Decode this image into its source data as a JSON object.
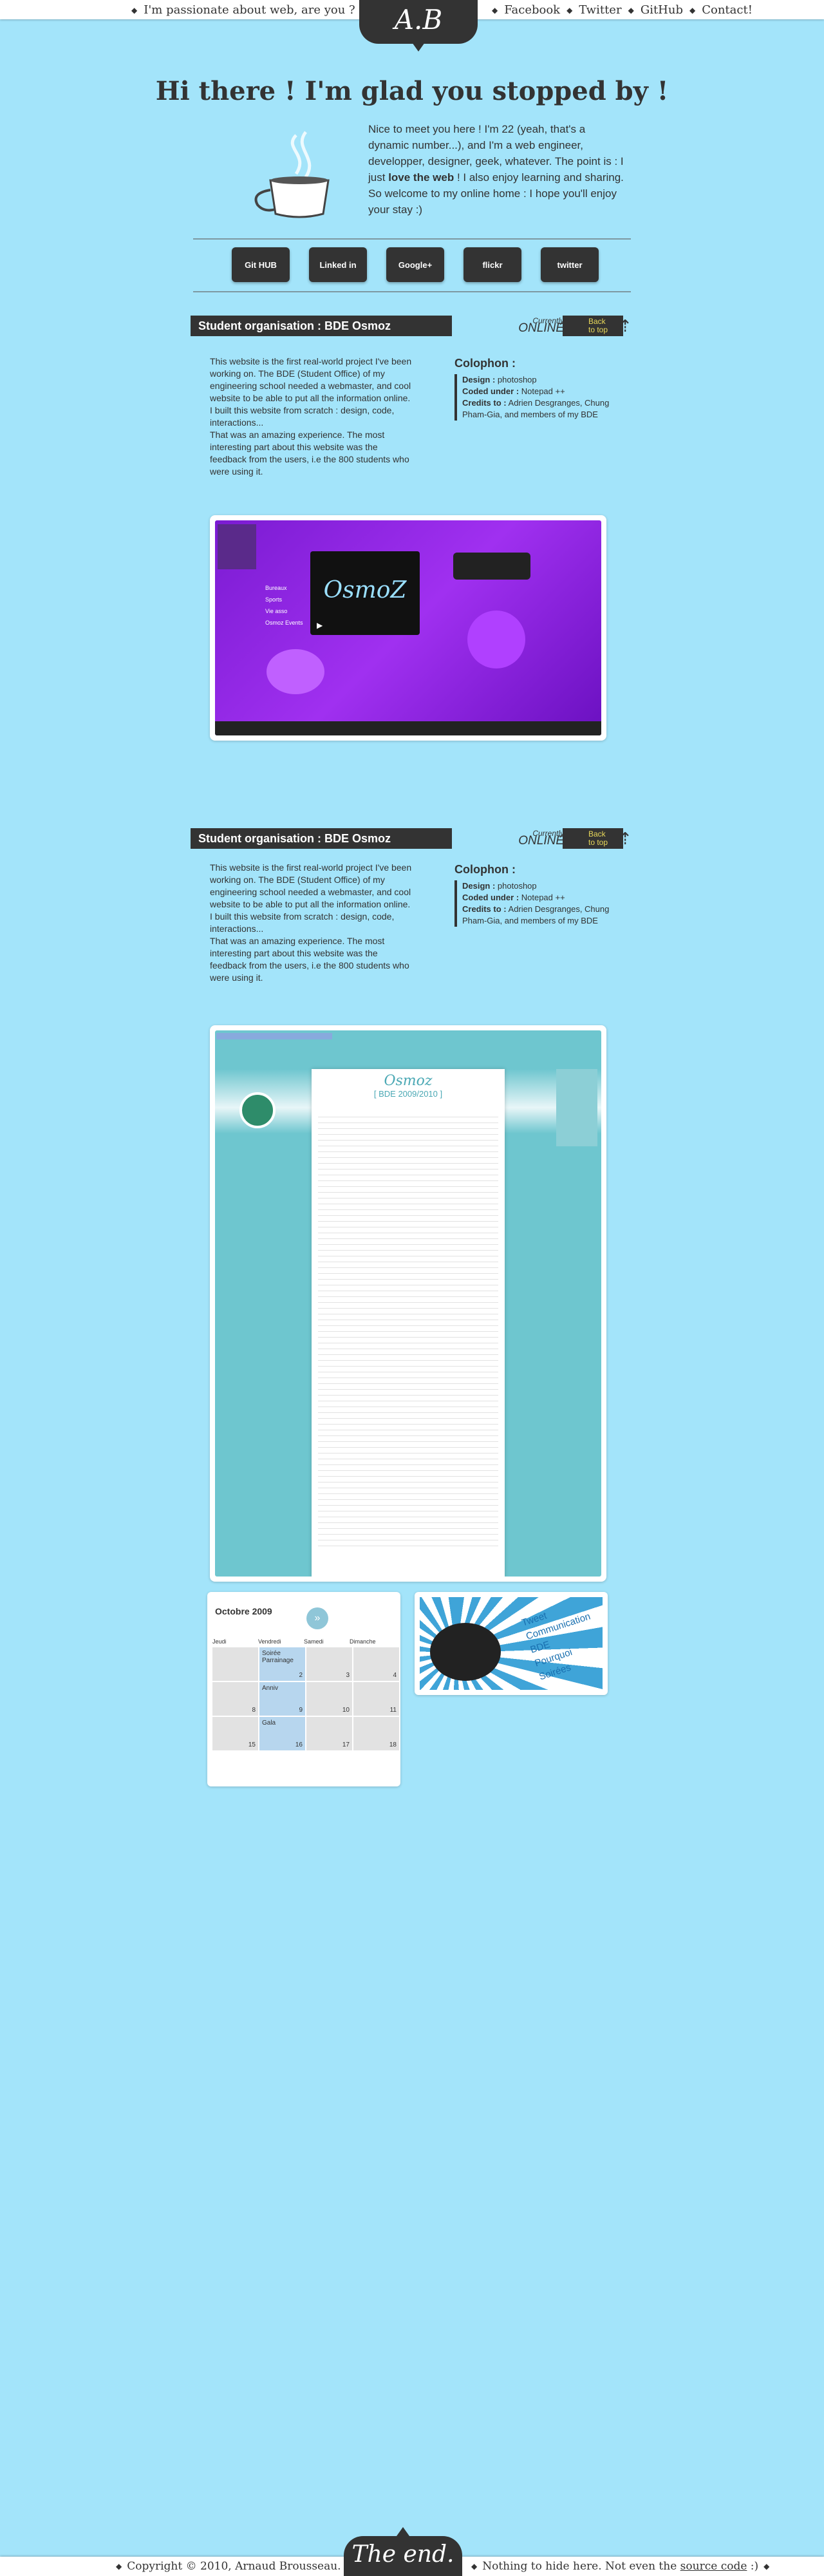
{
  "nav": {
    "tagline": "I'm passionate about web, are you ?",
    "links": [
      "Facebook",
      "Twitter",
      "GitHub",
      "Contact!"
    ],
    "separator": "◆"
  },
  "logo": "A.B",
  "intro": {
    "title": "Hi there ! I'm glad you stopped by !",
    "text_before_bold": "Nice to meet you here ! I'm 22 (yeah, that's a dynamic number...), and I'm a  web engineer, developper, designer, geek, whatever. The point is : I just ",
    "text_bold": "love the web",
    "text_after_bold": " ! I also enjoy learning and sharing. So welcome to my online home : I hope you'll enjoy your stay :)"
  },
  "social": [
    {
      "icon": "github-icon",
      "label": "Git HUB"
    },
    {
      "icon": "linkedin-icon",
      "label": "Linked in"
    },
    {
      "icon": "googleplus-icon",
      "label": "Google+"
    },
    {
      "icon": "flickr-icon",
      "label": "flickr"
    },
    {
      "icon": "twitter-icon",
      "label": "twitter"
    }
  ],
  "projects": [
    {
      "title": "Student organisation : BDE Osmoz",
      "status_top": "Currently",
      "status_bottom": "ONLINE",
      "back_line1": "Back",
      "back_line2": "to top",
      "description": "This website is the first real-world project I've been working on. The BDE (Student Office) of my engineering school needed a webmaster, and cool website to be able to put all the information online.\nI built this website from scratch : design, code, interactions...\nThat was an amazing experience. The most interesting part about this website was the feedback from the users, i.e the 800 students who were using it.",
      "colophon_title": "Colophon :",
      "design_label": "Design :",
      "design_value": "photoshop",
      "code_label": "Coded under :",
      "code_value": "Notepad ++",
      "credits_label": "Credits to :",
      "credits_value": "Adrien Desgranges, Chung Pham-Gia, and members of my BDE"
    },
    {
      "title": "Student organisation : BDE Osmoz",
      "status_top": "Currently",
      "status_bottom": "ONLINE",
      "back_line1": "Back",
      "back_line2": "to top",
      "description": "This website is the first real-world project I've been working on. The BDE (Student Office) of my engineering school needed a webmaster, and cool website to be able to put all the information online.\nI built this website from scratch : design, code, interactions...\nThat was an amazing experience. The most interesting part about this website was the feedback from the users, i.e the 800 students who were using it.",
      "colophon_title": "Colophon :",
      "design_label": "Design :",
      "design_value": "photoshop",
      "code_label": "Coded under :",
      "code_value": "Notepad ++",
      "credits_label": "Credits to :",
      "credits_value": "Adrien Desgranges, Chung Pham-Gia, and members of my BDE"
    }
  ],
  "screenshot1": {
    "logo_text": "OsmoZ",
    "menu": [
      "Bureaux",
      "Sports",
      "Vie asso",
      "Osmoz Events"
    ]
  },
  "screenshot2": {
    "logo_text": "Osmoz",
    "subtitle": "[ BDE 2009/2010 ]"
  },
  "calendar": {
    "title": "Octobre 2009",
    "next": "»",
    "days": [
      "Jeudi",
      "Vendredi",
      "Samedi",
      "Dimanche"
    ],
    "cells": [
      {
        "num": "",
        "event": "",
        "hl": false
      },
      {
        "num": "2",
        "event": "Soirée Parrainage",
        "hl": true
      },
      {
        "num": "3",
        "event": "",
        "hl": false
      },
      {
        "num": "4",
        "event": "",
        "hl": false
      },
      {
        "num": "8",
        "event": "",
        "hl": false
      },
      {
        "num": "9",
        "event": "Anniv",
        "hl": true
      },
      {
        "num": "10",
        "event": "",
        "hl": false
      },
      {
        "num": "11",
        "event": "",
        "hl": false
      },
      {
        "num": "15",
        "event": "",
        "hl": false
      },
      {
        "num": "16",
        "event": "Gala",
        "hl": true
      },
      {
        "num": "17",
        "event": "",
        "hl": false
      },
      {
        "num": "18",
        "event": "",
        "hl": false
      }
    ]
  },
  "promo": {
    "lines": [
      "Tweet",
      "Communication",
      "BDE",
      "Pourquoi",
      "Soirées"
    ]
  },
  "footer": {
    "copyright": "Copyright © 2010, Arnaud Brousseau.",
    "end": "The end.",
    "note_before_link": "Nothing to hide here. Not even the ",
    "note_link": "source code",
    "note_after_link": " :)"
  },
  "colors": {
    "background": "#a3e4fa",
    "dark": "#333333",
    "accent_yellow": "#e8d85a"
  }
}
